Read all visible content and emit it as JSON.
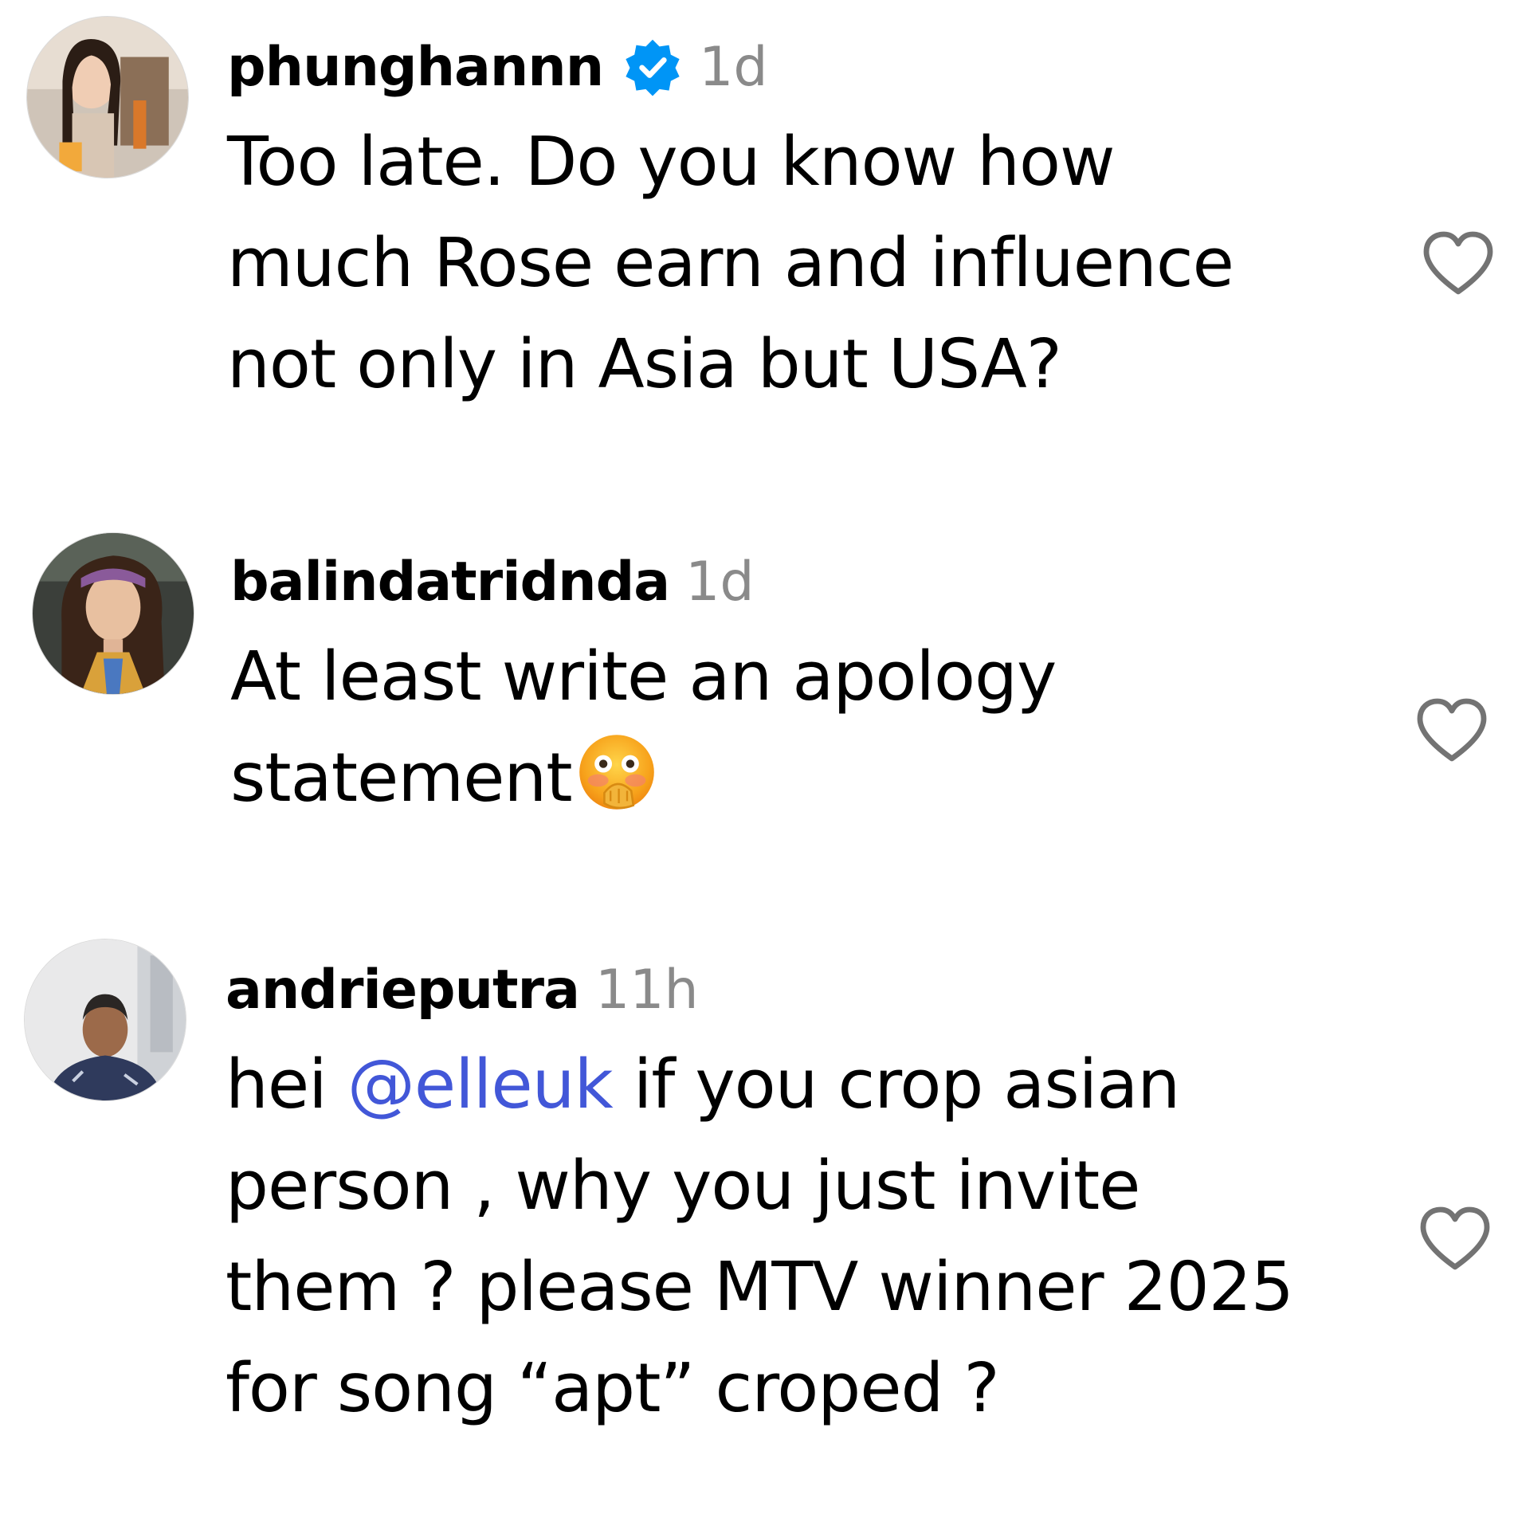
{
  "comments": [
    {
      "username": "phunghannn",
      "verified": true,
      "timestamp": "1d",
      "lines": [
        "Too late. Do you know how",
        "much Rose earn and influence",
        "not only in Asia but USA?"
      ]
    },
    {
      "username": "balindatridnda",
      "verified": false,
      "timestamp": "1d",
      "lines": [
        "At least write an apology",
        "statement"
      ],
      "emoji": "flushed-face-hand-over-mouth"
    },
    {
      "username": "andrieputra",
      "verified": false,
      "timestamp": "11h",
      "line1_prefix": "hei ",
      "mention": "@elleuk",
      "line1_suffix": " if you crop asian",
      "lines": [
        "person , why you just invite",
        "them ? please MTV winner 2025",
        "for song “apt” croped ?"
      ]
    }
  ],
  "colors": {
    "mention": "#4257d8",
    "timestamp": "#8a8a8a",
    "verified_badge": "#0095f6",
    "heart_outline": "#737373"
  },
  "icons": {
    "like": "heart-outline-icon",
    "verified": "verified-badge-icon"
  }
}
